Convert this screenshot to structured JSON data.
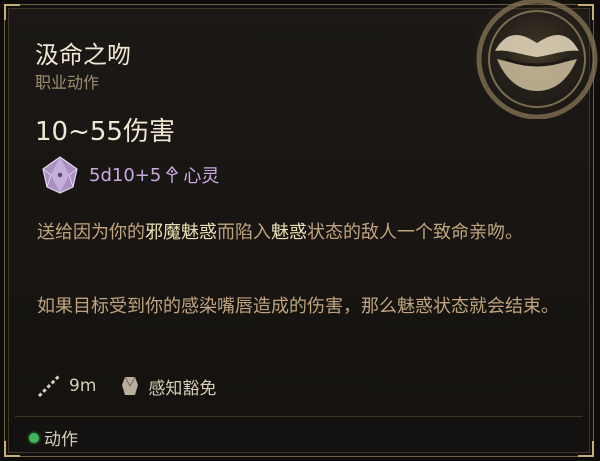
{
  "tooltip": {
    "title": "汲命之吻",
    "subtitle": "职业动作",
    "damage": "10~55伤害",
    "dice_formula": "5d10+5",
    "damage_type": "心灵",
    "desc1": {
      "part1": "送给因为你的",
      "hl1": "邪魔魅惑",
      "part2": "而陷入",
      "hl2": "魅惑",
      "part3": "状态的敌人一个致命亲吻。"
    },
    "desc2": "如果目标受到你的感染嘴唇造成的伤害，那么魅惑状态就会结束。",
    "range": "9m",
    "save": "感知豁免",
    "action_type": "动作"
  },
  "icons": {
    "emblem": "lips-icon",
    "dice": "d10-dice-icon",
    "damage_type": "psychic-icon",
    "range": "range-icon",
    "save": "saving-throw-icon",
    "action": "action-dot-icon"
  },
  "colors": {
    "title": "#efe6d3",
    "subtitle": "#9c8e6e",
    "description": "#bfa47e",
    "highlight": "#e9e2b4",
    "psychic": "#c9a9df",
    "action_dot": "#3fb65a",
    "border": "#c7b078"
  }
}
